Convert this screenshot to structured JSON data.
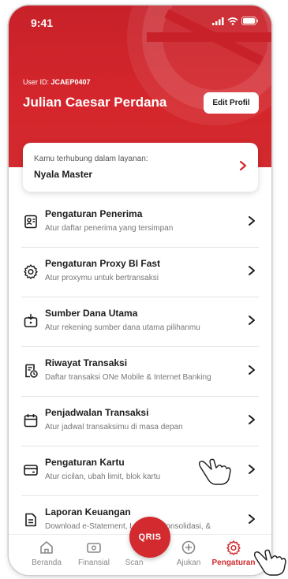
{
  "status_bar": {
    "time": "9:41"
  },
  "profile": {
    "user_id_label": "User ID:",
    "user_id": "JCAEP0407",
    "name": "Julian Caesar Perdana",
    "edit_button": "Edit Profil"
  },
  "service": {
    "subtitle": "Kamu terhubung dalam layanan:",
    "name": "Nyala Master"
  },
  "menu": [
    {
      "icon": "recipient-card-icon",
      "title": "Pengaturan Penerima",
      "desc": "Atur daftar penerima yang tersimpan"
    },
    {
      "icon": "gear-icon",
      "title": "Pengaturan Proxy BI Fast",
      "desc": "Atur proxymu untuk bertransaksi"
    },
    {
      "icon": "wallet-download-icon",
      "title": "Sumber Dana Utama",
      "desc": "Atur rekening sumber dana utama pilihanmu"
    },
    {
      "icon": "history-receipt-icon",
      "title": "Riwayat Transaksi",
      "desc": "Daftar transaksi ONe Mobile & Internet Banking"
    },
    {
      "icon": "calendar-icon",
      "title": "Penjadwalan Transaksi",
      "desc": "Atur jadwal transaksimu di masa depan"
    },
    {
      "icon": "credit-card-icon",
      "title": "Pengaturan Kartu",
      "desc": "Atur cicilan, ubah limit, blok kartu"
    },
    {
      "icon": "document-icon",
      "title": "Laporan Keuangan",
      "desc": "Download e-Statement, Laporan Konsolidasi, &"
    }
  ],
  "bottom_nav": {
    "items": [
      {
        "icon": "home-icon",
        "label": "Beranda"
      },
      {
        "icon": "wallet-icon",
        "label": "Finansial"
      },
      {
        "icon": "qris-icon",
        "label": "Scan"
      },
      {
        "icon": "plus-circle-icon",
        "label": "Ajukan"
      },
      {
        "icon": "gear-icon",
        "label": "Pengaturan"
      }
    ],
    "scan_button": "QRIS",
    "active": "Pengaturan"
  },
  "colors": {
    "brand_red": "#d22a2e",
    "text_dark": "#1c1c1c",
    "text_muted": "#777777"
  }
}
